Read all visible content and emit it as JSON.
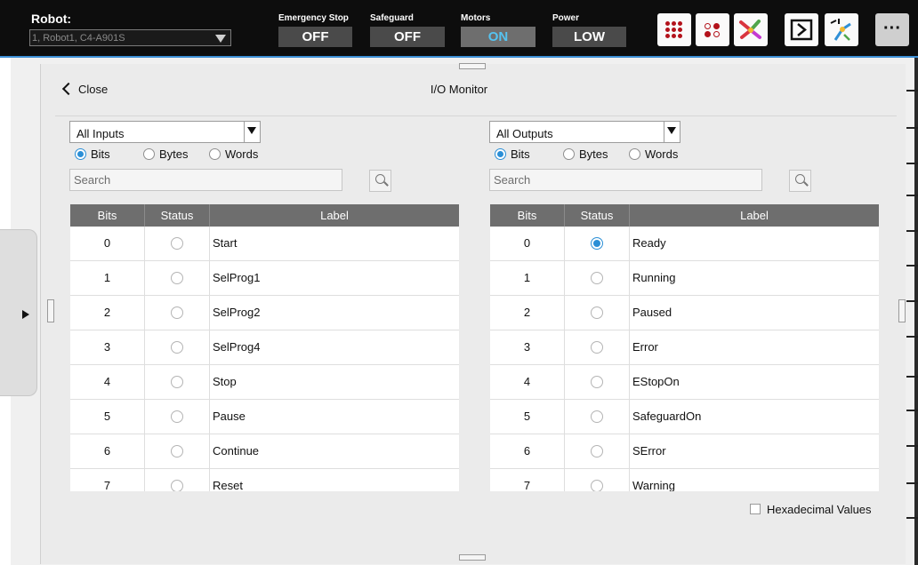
{
  "header": {
    "robot_label": "Robot:",
    "robot_select_value": "1, Robot1, C4-A901S",
    "statuses": [
      {
        "title": "Emergency Stop",
        "value": "OFF",
        "state": "off"
      },
      {
        "title": "Safeguard",
        "value": "OFF",
        "state": "off"
      },
      {
        "title": "Motors",
        "value": "ON",
        "state": "on"
      },
      {
        "title": "Power",
        "value": "LOW",
        "state": "off"
      }
    ],
    "toolbar_icons": [
      "io-dots-large-icon",
      "io-dots-small-icon",
      "robot-arm-icon",
      "run-window-icon",
      "jog-icon",
      "more-icon"
    ],
    "more_label": "···"
  },
  "panel": {
    "close_label": "Close",
    "title": "I/O Monitor"
  },
  "inputs": {
    "selector": "All Inputs",
    "radio_options": [
      "Bits",
      "Bytes",
      "Words"
    ],
    "selected_option": "Bits",
    "search_placeholder": "Search",
    "columns": [
      "Bits",
      "Status",
      "Label"
    ],
    "rows": [
      {
        "bit": "0",
        "on": false,
        "label": "Start"
      },
      {
        "bit": "1",
        "on": false,
        "label": "SelProg1"
      },
      {
        "bit": "2",
        "on": false,
        "label": "SelProg2"
      },
      {
        "bit": "3",
        "on": false,
        "label": "SelProg4"
      },
      {
        "bit": "4",
        "on": false,
        "label": "Stop"
      },
      {
        "bit": "5",
        "on": false,
        "label": "Pause"
      },
      {
        "bit": "6",
        "on": false,
        "label": "Continue"
      },
      {
        "bit": "7",
        "on": false,
        "label": "Reset"
      }
    ]
  },
  "outputs": {
    "selector": "All Outputs",
    "radio_options": [
      "Bits",
      "Bytes",
      "Words"
    ],
    "selected_option": "Bits",
    "search_placeholder": "Search",
    "columns": [
      "Bits",
      "Status",
      "Label"
    ],
    "rows": [
      {
        "bit": "0",
        "on": true,
        "label": "Ready"
      },
      {
        "bit": "1",
        "on": false,
        "label": "Running"
      },
      {
        "bit": "2",
        "on": false,
        "label": "Paused"
      },
      {
        "bit": "3",
        "on": false,
        "label": "Error"
      },
      {
        "bit": "4",
        "on": false,
        "label": "EStopOn"
      },
      {
        "bit": "5",
        "on": false,
        "label": "SafeguardOn"
      },
      {
        "bit": "6",
        "on": false,
        "label": "SError"
      },
      {
        "bit": "7",
        "on": false,
        "label": "Warning"
      }
    ]
  },
  "footer": {
    "hex_label": "Hexadecimal Values",
    "hex_checked": false
  },
  "colors": {
    "accent": "#2b8fd6",
    "topbar": "#0d0d0d",
    "table_header": "#6e6e6e",
    "motors_on": "#55c3f0"
  }
}
